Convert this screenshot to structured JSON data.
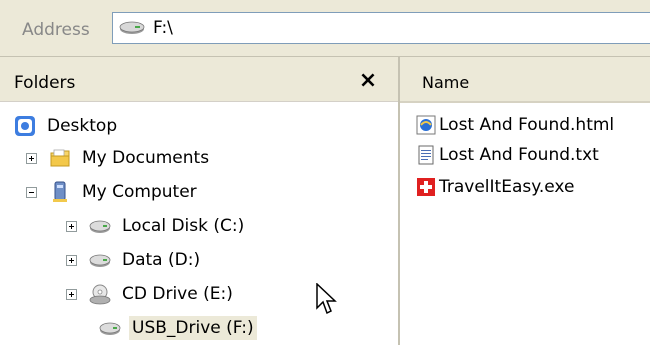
{
  "address": {
    "label": "Address",
    "value": "F:\\",
    "icon": "drive-icon"
  },
  "folders_pane": {
    "title": "Folders",
    "close_label": "×",
    "tree": [
      {
        "label": "Desktop",
        "icon": "desktop-icon",
        "expander": "none"
      },
      {
        "label": "My Documents",
        "icon": "folder-icon",
        "expander": "plus"
      },
      {
        "label": "My Computer",
        "icon": "computer-icon",
        "expander": "minus"
      },
      {
        "label": "Local Disk (C:)",
        "icon": "hard-drive-icon",
        "expander": "plus"
      },
      {
        "label": "Data (D:)",
        "icon": "hard-drive-icon",
        "expander": "plus"
      },
      {
        "label": "CD Drive (E:)",
        "icon": "cd-drive-icon",
        "expander": "plus"
      },
      {
        "label": "USB_Drive (F:)",
        "icon": "usb-drive-icon",
        "expander": "none",
        "selected": true
      }
    ]
  },
  "files_pane": {
    "column_name": "Name",
    "files": [
      {
        "name": "Lost And Found.html",
        "icon": "html-file-icon"
      },
      {
        "name": "Lost And Found.txt",
        "icon": "text-file-icon"
      },
      {
        "name": "TravelItEasy.exe",
        "icon": "exe-file-icon"
      }
    ]
  },
  "colors": {
    "chrome": "#ece9d8",
    "border": "#7f9db9",
    "exe_red": "#e02020"
  }
}
